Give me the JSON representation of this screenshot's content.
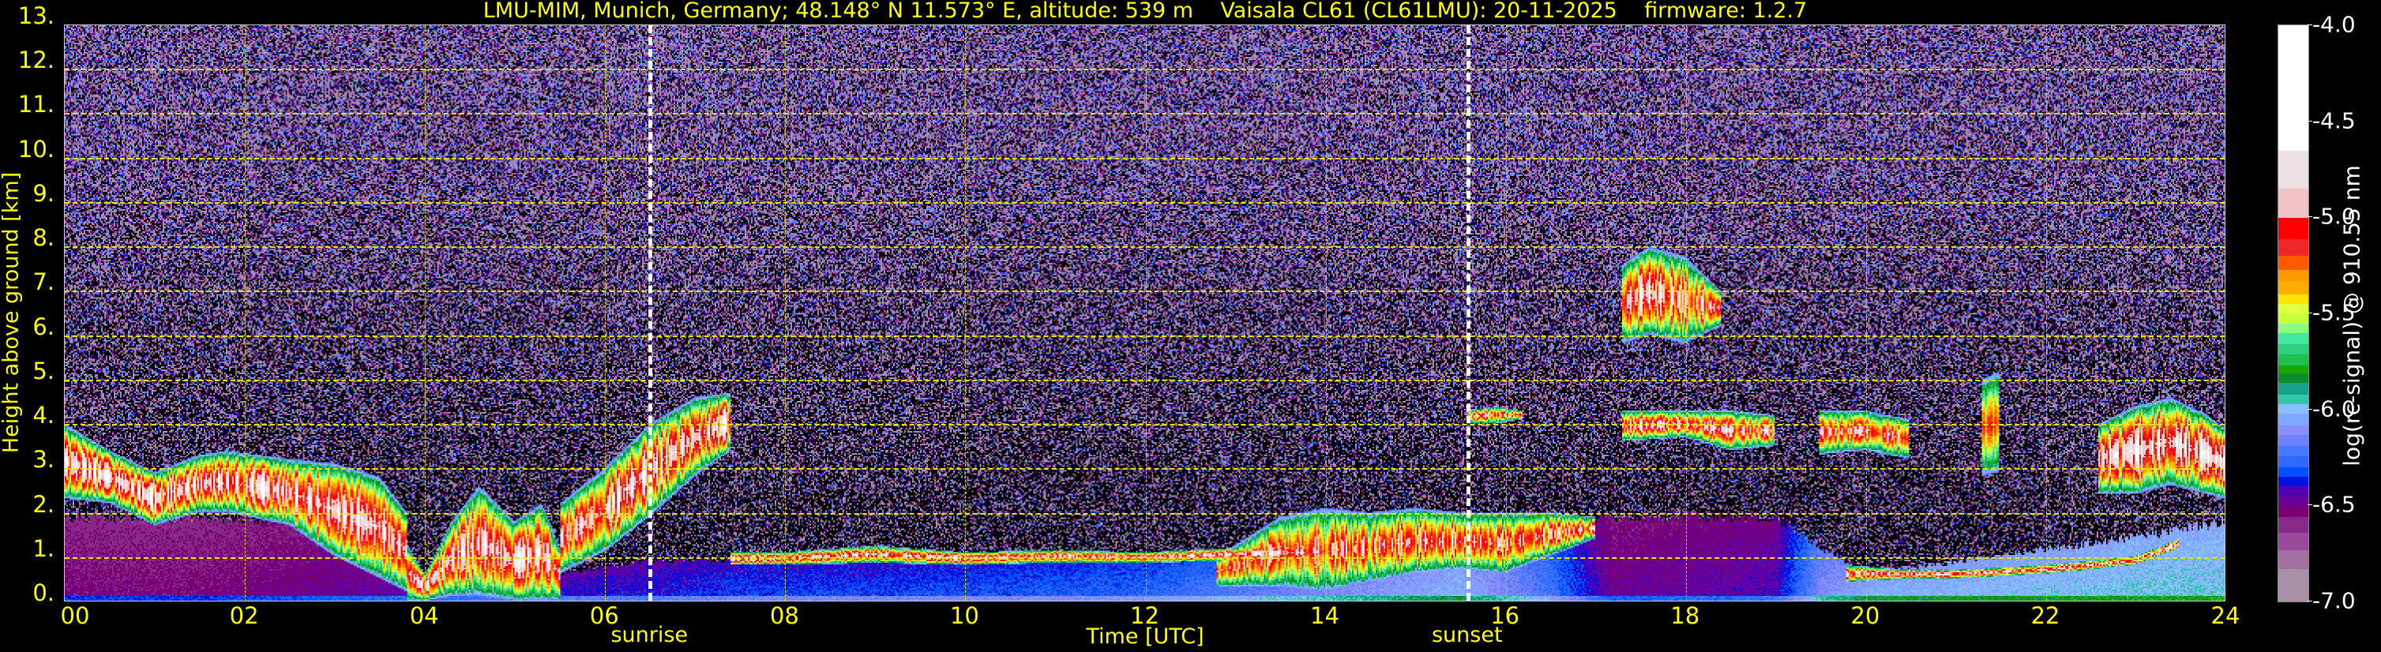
{
  "title": "LMU-MIM, Munich, Germany; 48.148° N 11.573° E, altitude: 539 m    Vaisala CL61 (CL61LMU): 20-11-2025    firmware: 1.2.7",
  "chart_data": {
    "type": "heatmap",
    "title": "LMU-MIM, Munich, Germany; 48.148° N 11.573° E, altitude: 539 m    Vaisala CL61 (CL61LMU): 20-11-2025    firmware: 1.2.7",
    "xlabel": "Time [UTC]",
    "ylabel": "Height above ground [km]",
    "xlim": [
      0,
      24
    ],
    "ylim": [
      0,
      13
    ],
    "x_ticks": [
      "00",
      "02",
      "04",
      "06",
      "08",
      "10",
      "12",
      "14",
      "16",
      "18",
      "20",
      "22",
      "24"
    ],
    "x_tick_values": [
      0,
      2,
      4,
      6,
      8,
      10,
      12,
      14,
      16,
      18,
      20,
      22,
      24
    ],
    "y_ticks": [
      "0.",
      "1.",
      "2.",
      "3.",
      "4.",
      "5.",
      "6.",
      "7.",
      "8.",
      "9.",
      "10.",
      "11.",
      "12.",
      "13."
    ],
    "y_tick_values": [
      0,
      1,
      2,
      3,
      4,
      5,
      6,
      7,
      8,
      9,
      10,
      11,
      12,
      13
    ],
    "grid": true,
    "grid_color": "#ffff00",
    "events": [
      {
        "label": "sunrise",
        "time": 6.5
      },
      {
        "label": "sunset",
        "time": 15.58
      }
    ],
    "colorbar": {
      "label": "log(rc-signal) @ 910.55 nm",
      "range": [
        -7.0,
        -4.0
      ],
      "ticks": [
        "-4.0",
        "-4.5",
        "-5.0",
        "-5.5",
        "-6.0",
        "-6.5",
        "-7.0"
      ],
      "tick_values": [
        -4.0,
        -4.5,
        -5.0,
        -5.5,
        -6.0,
        -6.5,
        -7.0
      ],
      "bands": [
        {
          "from": -7.0,
          "to": -6.83,
          "color": "#a890a8"
        },
        {
          "from": -6.83,
          "to": -6.73,
          "color": "#a070a0"
        },
        {
          "from": -6.73,
          "to": -6.64,
          "color": "#984a98"
        },
        {
          "from": -6.64,
          "to": -6.56,
          "color": "#882888"
        },
        {
          "from": -6.56,
          "to": -6.5,
          "color": "#780070"
        },
        {
          "from": -6.5,
          "to": -6.45,
          "color": "#6a0098"
        },
        {
          "from": -6.45,
          "to": -6.4,
          "color": "#5000b0"
        },
        {
          "from": -6.4,
          "to": -6.35,
          "color": "#0010e0"
        },
        {
          "from": -6.35,
          "to": -6.3,
          "color": "#0050ff"
        },
        {
          "from": -6.3,
          "to": -6.24,
          "color": "#3068ff"
        },
        {
          "from": -6.24,
          "to": -6.19,
          "color": "#4878ff"
        },
        {
          "from": -6.19,
          "to": -6.13,
          "color": "#7080ff"
        },
        {
          "from": -6.13,
          "to": -6.08,
          "color": "#8890ff"
        },
        {
          "from": -6.08,
          "to": -6.02,
          "color": "#80a8ff"
        },
        {
          "from": -6.02,
          "to": -5.97,
          "color": "#88c0ff"
        },
        {
          "from": -5.97,
          "to": -5.92,
          "color": "#30c8a8"
        },
        {
          "from": -5.92,
          "to": -5.86,
          "color": "#18a088"
        },
        {
          "from": -5.86,
          "to": -5.81,
          "color": "#108c2a"
        },
        {
          "from": -5.81,
          "to": -5.77,
          "color": "#18a800"
        },
        {
          "from": -5.77,
          "to": -5.71,
          "color": "#20c050"
        },
        {
          "from": -5.71,
          "to": -5.66,
          "color": "#2ed080"
        },
        {
          "from": -5.66,
          "to": -5.6,
          "color": "#40e8a0"
        },
        {
          "from": -5.6,
          "to": -5.55,
          "color": "#8cff80"
        },
        {
          "from": -5.55,
          "to": -5.5,
          "color": "#c8ff40"
        },
        {
          "from": -5.5,
          "to": -5.45,
          "color": "#e0ff40"
        },
        {
          "from": -5.45,
          "to": -5.4,
          "color": "#ffe400"
        },
        {
          "from": -5.4,
          "to": -5.33,
          "color": "#ffae00"
        },
        {
          "from": -5.33,
          "to": -5.27,
          "color": "#ff9a00"
        },
        {
          "from": -5.27,
          "to": -5.2,
          "color": "#ff5a00"
        },
        {
          "from": -5.2,
          "to": -5.11,
          "color": "#ef2626"
        },
        {
          "from": -5.11,
          "to": -5.0,
          "color": "#ff0000"
        },
        {
          "from": -5.0,
          "to": -4.85,
          "color": "#f0c4c4"
        },
        {
          "from": -4.85,
          "to": -4.65,
          "color": "#ece0e2"
        },
        {
          "from": -4.65,
          "to": -4.0,
          "color": "#ffffff"
        }
      ]
    },
    "aerosol_layer": {
      "time": [
        0,
        1.5,
        3.0,
        4.0,
        5.5,
        6.5,
        7.5,
        9,
        12,
        14,
        15.5,
        16.5,
        17.2,
        19.0,
        19.5,
        20.0,
        23.2,
        24
      ],
      "top_km": [
        1.9,
        1.9,
        1.8,
        0.4,
        0.6,
        0.9,
        0.9,
        0.9,
        0.9,
        1.0,
        1.3,
        1.5,
        1.9,
        1.9,
        1.2,
        0.6,
        1.5,
        1.8
      ],
      "log_signal": [
        -6.6,
        -6.6,
        -6.55,
        -6.5,
        -6.45,
        -6.45,
        -6.4,
        -6.4,
        -6.35,
        -6.2,
        -6.1,
        -6.3,
        -6.55,
        -6.5,
        -6.2,
        -6.1,
        -6.05,
        -6.05
      ]
    },
    "cloud_layers": [
      {
        "time": [
          0,
          0.5,
          1.0,
          1.5,
          1.8,
          2.5,
          3.0,
          3.5,
          3.8
        ],
        "base_km": [
          2.3,
          2.2,
          1.7,
          2.0,
          2.0,
          1.7,
          1.0,
          0.5,
          0.2
        ],
        "top_km": [
          4.0,
          3.4,
          2.9,
          3.3,
          3.4,
          3.2,
          3.1,
          2.8,
          2.0
        ],
        "peak": -4.1
      },
      {
        "time": [
          3.8,
          4.0,
          4.3,
          4.6,
          5.0,
          5.3,
          5.5
        ],
        "base_km": [
          0.0,
          0.0,
          0.1,
          0.1,
          0.0,
          0.0,
          0.0
        ],
        "top_km": [
          1.3,
          0.6,
          1.8,
          2.6,
          1.8,
          2.2,
          1.2
        ],
        "peak": -4.2
      },
      {
        "time": [
          5.5,
          6.0,
          6.5,
          7.0,
          7.4
        ],
        "base_km": [
          0.6,
          1.1,
          1.9,
          2.8,
          3.4
        ],
        "top_km": [
          2.2,
          3.0,
          4.0,
          4.6,
          4.7
        ],
        "peak": -4.2
      },
      {
        "time": [
          7.4,
          8,
          9,
          10,
          11,
          12,
          13,
          14
        ],
        "base_km": [
          0.8,
          0.8,
          0.85,
          0.8,
          0.85,
          0.85,
          0.9,
          0.9
        ],
        "top_km": [
          1.1,
          1.1,
          1.25,
          1.1,
          1.15,
          1.1,
          1.2,
          1.3
        ],
        "peak": -4.2
      },
      {
        "time": [
          12.8,
          13.5,
          14,
          14.5,
          15,
          15.5,
          16,
          16.5,
          17.0
        ],
        "base_km": [
          0.3,
          0.3,
          0.2,
          0.4,
          0.6,
          0.7,
          0.6,
          1.0,
          1.4
        ],
        "top_km": [
          1.0,
          1.9,
          2.1,
          2.0,
          2.1,
          2.0,
          2.0,
          2.0,
          1.9
        ],
        "peak": -4.5
      },
      {
        "time": [
          15.6,
          15.9,
          16.2
        ],
        "base_km": [
          4.0,
          4.0,
          4.1
        ],
        "top_km": [
          4.3,
          4.4,
          4.3
        ],
        "peak": -4.6
      },
      {
        "time": [
          17.3,
          17.6,
          18.0,
          18.4
        ],
        "base_km": [
          5.8,
          6.0,
          5.8,
          6.2
        ],
        "top_km": [
          7.6,
          8.0,
          7.8,
          7.0
        ],
        "peak": -4.3
      },
      {
        "time": [
          17.3,
          18.0,
          18.5,
          19.0
        ],
        "base_km": [
          3.6,
          3.7,
          3.4,
          3.5
        ],
        "top_km": [
          4.3,
          4.3,
          4.3,
          4.2
        ],
        "peak": -4.3
      },
      {
        "time": [
          19.5,
          20.0,
          20.5
        ],
        "base_km": [
          3.3,
          3.4,
          3.2
        ],
        "top_km": [
          4.3,
          4.3,
          4.1
        ],
        "peak": -4.4
      },
      {
        "time": [
          19.8,
          20.5,
          21,
          22,
          23,
          23.5
        ],
        "base_km": [
          0.4,
          0.5,
          0.5,
          0.6,
          0.8,
          1.2
        ],
        "top_km": [
          0.8,
          0.7,
          0.7,
          0.8,
          1.0,
          1.4
        ],
        "peak": -4.2
      },
      {
        "time": [
          21.3,
          21.5
        ],
        "base_km": [
          2.8,
          2.9
        ],
        "top_km": [
          5.0,
          5.2
        ],
        "peak": -4.8
      },
      {
        "time": [
          22.6,
          23.0,
          23.4,
          23.8,
          24
        ],
        "base_km": [
          2.4,
          2.4,
          2.6,
          2.4,
          2.3
        ],
        "top_km": [
          4.0,
          4.4,
          4.6,
          4.2,
          3.9
        ],
        "peak": -4.1
      }
    ]
  }
}
